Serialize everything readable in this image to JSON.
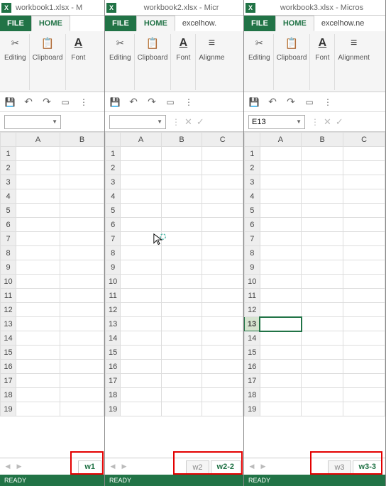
{
  "windows": [
    {
      "title": "workbook1.xlsx - M",
      "tabs": {
        "file": "FILE",
        "home": "HOME"
      },
      "ribbon": {
        "editing": "Editing",
        "clipboard": "Clipboard",
        "font": "Font"
      },
      "namebox": "",
      "rows": [
        "1",
        "2",
        "3",
        "4",
        "5",
        "6",
        "7",
        "8",
        "9",
        "10",
        "11",
        "12",
        "13",
        "14",
        "15",
        "16",
        "17",
        "18",
        "19"
      ],
      "cols": [
        "A",
        "B"
      ],
      "sheets": {
        "tabs": [
          "w1"
        ],
        "active": "w1"
      },
      "status": "READY"
    },
    {
      "title": "workbook2.xlsx - Micr",
      "tabs": {
        "file": "FILE",
        "home": "HOME",
        "other": "excelhow."
      },
      "ribbon": {
        "editing": "Editing",
        "clipboard": "Clipboard",
        "font": "Font",
        "alignment": "Alignme"
      },
      "namebox": "",
      "rows": [
        "1",
        "2",
        "3",
        "4",
        "5",
        "6",
        "7",
        "8",
        "9",
        "10",
        "11",
        "12",
        "13",
        "14",
        "15",
        "16",
        "17",
        "18",
        "19"
      ],
      "cols": [
        "A",
        "B",
        "C"
      ],
      "sheets": {
        "tabs": [
          "w2",
          "w2-2"
        ],
        "active": "w2-2"
      },
      "status": "READY"
    },
    {
      "title": "workbook3.xlsx - Micros",
      "tabs": {
        "file": "FILE",
        "home": "HOME",
        "other": "excelhow.ne"
      },
      "ribbon": {
        "editing": "Editing",
        "clipboard": "Clipboard",
        "font": "Font",
        "alignment": "Alignment"
      },
      "namebox": "E13",
      "rows": [
        "1",
        "2",
        "3",
        "4",
        "5",
        "6",
        "7",
        "8",
        "9",
        "10",
        "11",
        "12",
        "13",
        "14",
        "15",
        "16",
        "17",
        "18",
        "19"
      ],
      "cols": [
        "A",
        "B",
        "C"
      ],
      "selected_row": "13",
      "sheets": {
        "tabs": [
          "w3",
          "w3-3"
        ],
        "active": "w3-3"
      },
      "status": "READY"
    }
  ]
}
